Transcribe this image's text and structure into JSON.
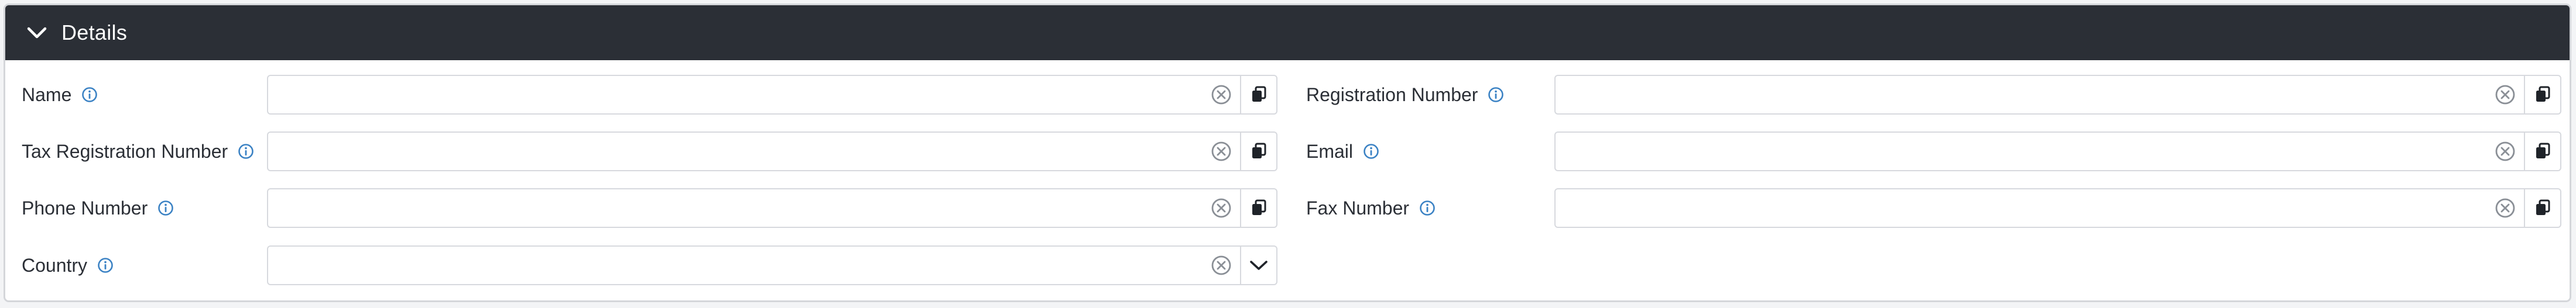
{
  "section": {
    "title": "Details",
    "expanded": true
  },
  "fields": {
    "name": {
      "label": "Name",
      "value": "",
      "action_icon": "copy-icon"
    },
    "registration_number": {
      "label": "Registration Number",
      "value": "",
      "action_icon": "copy-icon"
    },
    "tax_registration_number": {
      "label": "Tax Registration Number",
      "value": "",
      "action_icon": "copy-icon"
    },
    "email": {
      "label": "Email",
      "value": "",
      "action_icon": "copy-icon"
    },
    "phone_number": {
      "label": "Phone Number",
      "value": "",
      "action_icon": "copy-icon"
    },
    "fax_number": {
      "label": "Fax Number",
      "value": "",
      "action_icon": "copy-icon"
    },
    "country": {
      "label": "Country",
      "value": "",
      "action_icon": "chevron-down-icon"
    }
  },
  "colors": {
    "header_bg": "#2b2f36",
    "header_text": "#ffffff",
    "info_icon": "#3b82c4",
    "clear_icon": "#8a8f96",
    "field_border": "#d7d9de"
  }
}
